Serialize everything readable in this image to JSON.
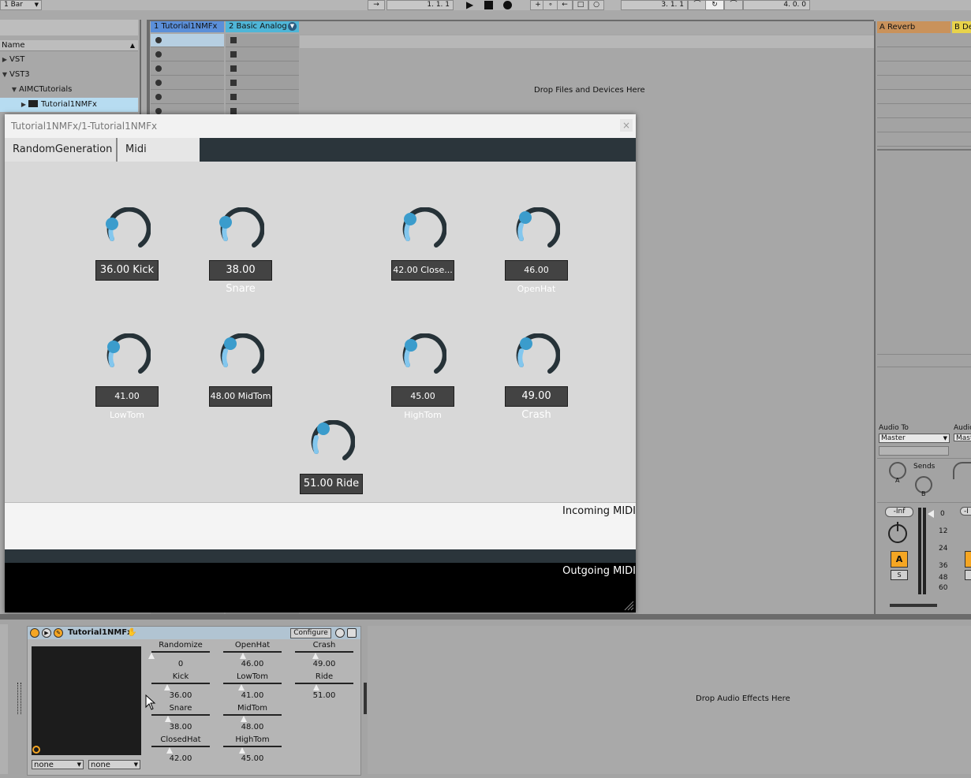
{
  "transport": {
    "quantize": "1 Bar",
    "position": "1.   1.   1",
    "loop_start": "3.   1.   1",
    "loop_length": "4.   0.   0"
  },
  "browser": {
    "header": "Name",
    "items": [
      {
        "label": "VST",
        "expanded": false
      },
      {
        "label": "VST3",
        "expanded": true
      },
      {
        "label": "AIMCTutorials",
        "expanded": true
      },
      {
        "label": "Tutorial1NMFx",
        "expanded": false,
        "selected": true
      }
    ]
  },
  "session": {
    "tracks": [
      {
        "name": "1 Tutorial1NMFx",
        "color": "#5b8fd9"
      },
      {
        "name": "2 Basic Analog",
        "color": "#4fb6d8"
      }
    ],
    "returns": [
      {
        "name": "A Reverb",
        "color": "#c9925b"
      },
      {
        "name": "B De",
        "color": "#e8d34a"
      }
    ],
    "drop_text": "Drop Files and Devices Here"
  },
  "mixer": {
    "audio_to_label": "Audio To",
    "audio_to_value": "Master",
    "sends_label": "Sends",
    "send_a": "A",
    "send_b": "B",
    "volume": "-Inf",
    "meter_ticks": [
      "0",
      "12",
      "24",
      "36",
      "48",
      "60"
    ],
    "activator": "A",
    "solo": "S",
    "audio_to_label_b": "Audio",
    "audio_to_value_b": "Mast",
    "volume_b": "-I"
  },
  "plugin_window": {
    "title": "Tutorial1NMFx/1-Tutorial1NMFx",
    "close": "×",
    "tabs": [
      "RandomGeneration",
      "Midi Mappings"
    ],
    "active_tab": 1,
    "knobs": [
      {
        "label": "36.00 Kick"
      },
      {
        "label": "38.00 Snare"
      },
      {
        "label": "42.00 Close..."
      },
      {
        "label": "46.00 OpenHat"
      },
      {
        "label": "41.00 LowTom"
      },
      {
        "label": "48.00 MidTom"
      },
      {
        "label": "45.00 HighTom"
      },
      {
        "label": "49.00 Crash"
      },
      {
        "label": "51.00 Ride"
      }
    ],
    "incoming_label": "Incoming MIDI",
    "outgoing_label": "Outgoing MIDI"
  },
  "device": {
    "name": "Tutorial1NMFx",
    "configure": "Configure",
    "select_a": "none",
    "select_b": "none",
    "params": [
      {
        "name": "Randomize",
        "value": "0"
      },
      {
        "name": "Kick",
        "value": "36.00"
      },
      {
        "name": "Snare",
        "value": "38.00"
      },
      {
        "name": "ClosedHat",
        "value": "42.00"
      },
      {
        "name": "OpenHat",
        "value": "46.00"
      },
      {
        "name": "LowTom",
        "value": "41.00"
      },
      {
        "name": "MidTom",
        "value": "48.00"
      },
      {
        "name": "HighTom",
        "value": "45.00"
      },
      {
        "name": "Crash",
        "value": "49.00"
      },
      {
        "name": "Ride",
        "value": "51.00"
      }
    ],
    "drop_text": "Drop Audio Effects Here"
  }
}
